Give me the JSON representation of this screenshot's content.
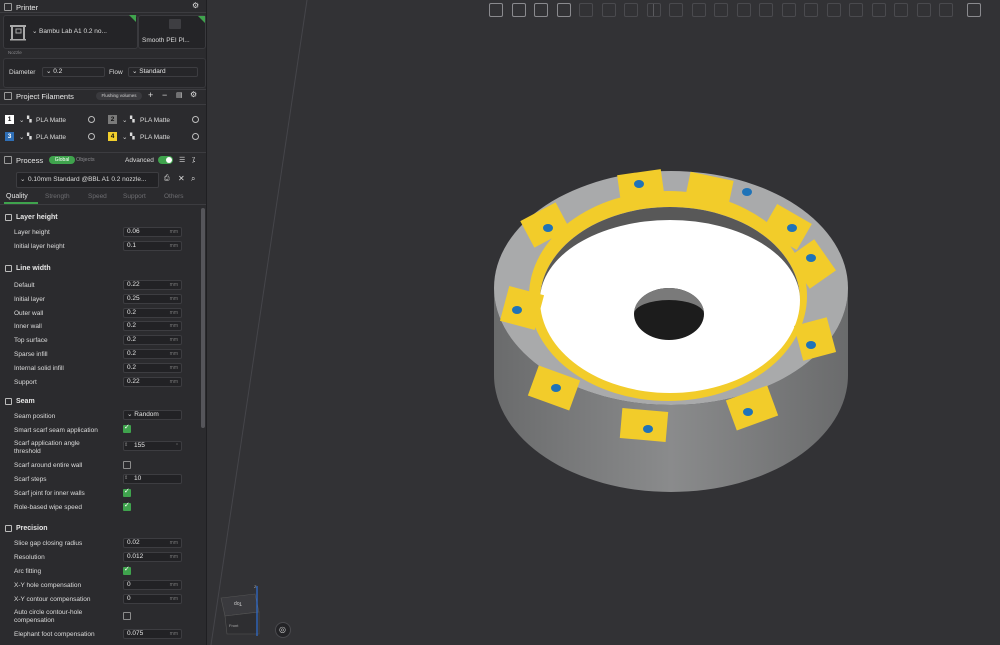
{
  "printer": {
    "title": "Printer",
    "printer_name": "Bambu Lab A1 0.2 no...",
    "plate_name": "Smooth PEI Pl...",
    "nozzle_caption": "Nozzle",
    "diameter_label": "Diameter",
    "diameter_value": "0.2",
    "flow_label": "Flow",
    "flow_value": "Standard"
  },
  "filaments": {
    "title": "Project Filaments",
    "flushing_label": "Flushing volumes",
    "items": [
      {
        "num": "1",
        "name": "PLA Matte",
        "badge_color": "#ffffff",
        "text_color": "#111111"
      },
      {
        "num": "2",
        "name": "PLA Matte",
        "badge_color": "#7a7a7a",
        "text_color": "#111111"
      },
      {
        "num": "3",
        "name": "PLA Matte",
        "badge_color": "#2f6fb6",
        "text_color": "#ffffff"
      },
      {
        "num": "4",
        "name": "PLA Matte",
        "badge_color": "#f2cf2c",
        "text_color": "#111111"
      }
    ]
  },
  "process": {
    "title": "Process",
    "global_label": "Global",
    "objects_label": "Objects",
    "advanced_label": "Advanced",
    "preset": "0.10mm Standard @BBL A1 0.2 nozzle...",
    "tabs": [
      "Quality",
      "Strength",
      "Speed",
      "Support",
      "Others"
    ]
  },
  "settings": {
    "layer_height": {
      "title": "Layer height",
      "rows": [
        {
          "label": "Layer height",
          "value": "0.06",
          "unit": "mm"
        },
        {
          "label": "Initial layer height",
          "value": "0.1",
          "unit": "mm"
        }
      ]
    },
    "line_width": {
      "title": "Line width",
      "rows": [
        {
          "label": "Default",
          "value": "0.22",
          "unit": "mm"
        },
        {
          "label": "Initial layer",
          "value": "0.25",
          "unit": "mm"
        },
        {
          "label": "Outer wall",
          "value": "0.2",
          "unit": "mm"
        },
        {
          "label": "Inner wall",
          "value": "0.2",
          "unit": "mm"
        },
        {
          "label": "Top surface",
          "value": "0.2",
          "unit": "mm"
        },
        {
          "label": "Sparse infill",
          "value": "0.2",
          "unit": "mm"
        },
        {
          "label": "Internal solid infill",
          "value": "0.2",
          "unit": "mm"
        },
        {
          "label": "Support",
          "value": "0.22",
          "unit": "mm"
        }
      ]
    },
    "seam": {
      "title": "Seam",
      "seam_position_label": "Seam position",
      "seam_position_value": "Random",
      "smart_scarf_label": "Smart scarf seam application",
      "scarf_angle_label_1": "Scarf application angle",
      "scarf_angle_label_2": "threshold",
      "scarf_angle_value": "155",
      "scarf_angle_unit": "°",
      "scarf_entire_label": "Scarf around entire wall",
      "scarf_steps_label": "Scarf steps",
      "scarf_steps_value": "10",
      "scarf_inner_label": "Scarf joint for inner walls",
      "role_wipe_label": "Role-based wipe speed"
    },
    "precision": {
      "title": "Precision",
      "slice_gap_label": "Slice gap closing radius",
      "slice_gap_value": "0.02",
      "resolution_label": "Resolution",
      "resolution_value": "0.012",
      "arc_label": "Arc fitting",
      "xy_hole_label": "X-Y hole compensation",
      "xy_hole_value": "0",
      "xy_contour_label": "X-Y contour compensation",
      "xy_contour_value": "0",
      "auto_circle_label_1": "Auto circle contour-hole",
      "auto_circle_label_2": "compensation",
      "elephant_label": "Elephant foot compensation",
      "elephant_value": "0.075",
      "unit": "mm"
    }
  },
  "viewport": {
    "view_cube_top": "Top",
    "view_cube_front": "Front",
    "axis_label": "Z"
  }
}
